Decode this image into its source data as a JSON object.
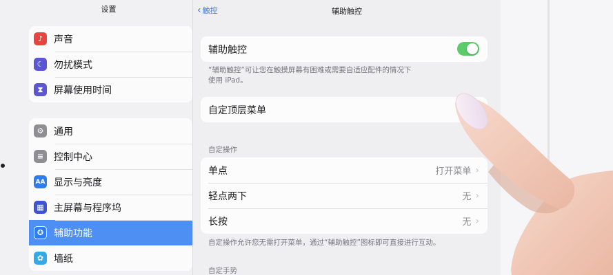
{
  "sidebar": {
    "title": "设置",
    "group1": [
      {
        "label": "声音",
        "icon": "speaker-icon",
        "color": "#e9453f",
        "glyph": "♪"
      },
      {
        "label": "勿扰模式",
        "icon": "moon-icon",
        "color": "#5b56d3",
        "glyph": "☾"
      },
      {
        "label": "屏幕使用时间",
        "icon": "hourglass-icon",
        "color": "#5b56d3",
        "glyph": "⧗"
      }
    ],
    "group2": [
      {
        "label": "通用",
        "icon": "gear-icon",
        "color": "#8e8e93",
        "glyph": "⚙"
      },
      {
        "label": "控制中心",
        "icon": "toggles-icon",
        "color": "#8e8e93",
        "glyph": "≡"
      },
      {
        "label": "显示与亮度",
        "icon": "text-size-icon",
        "color": "#2f7bf0",
        "glyph": "AA"
      },
      {
        "label": "主屏幕与程序坞",
        "icon": "home-grid-icon",
        "color": "#3d53d6",
        "glyph": "▦"
      },
      {
        "label": "辅助功能",
        "icon": "accessibility-icon",
        "color": "#2f7bf0",
        "glyph": "✪",
        "selected": true
      },
      {
        "label": "墙纸",
        "icon": "flower-icon",
        "color": "#36a8e6",
        "glyph": "✿"
      }
    ]
  },
  "detail": {
    "back_label": "触控",
    "title": "辅助触控",
    "assistive_touch": {
      "label": "辅助触控",
      "enabled": true,
      "toggle_color": "#5ccc6a"
    },
    "assistive_note_line1": "“辅助触控”可让您在触摸屏幕有困难或需要自适应配件的情况下",
    "assistive_note_line2": "使用 iPad。",
    "custom_top_menu": "自定顶层菜单",
    "custom_actions_header": "自定操作",
    "actions": [
      {
        "label": "单点",
        "value": "打开菜单"
      },
      {
        "label": "轻点两下",
        "value": "无"
      },
      {
        "label": "长按",
        "value": "无"
      }
    ],
    "actions_note": "自定操作允许您无需打开菜单，通过“辅助触控”图标即可直接进行互动。",
    "custom_gestures_header": "自定手势"
  },
  "colors": {
    "accent": "#4d8ff3",
    "link": "#3b79e3"
  }
}
